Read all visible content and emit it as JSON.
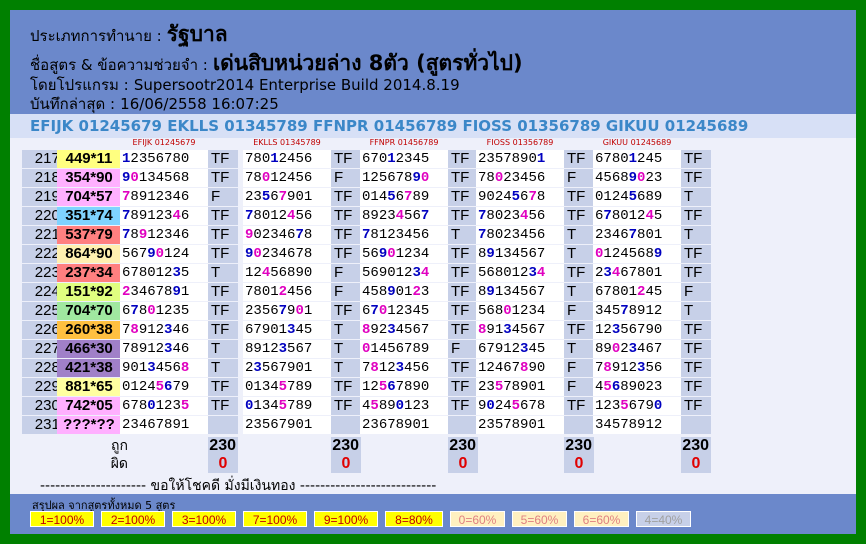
{
  "header": {
    "type_label": "ประเภทการทำนาย :",
    "type_value": "รัฐบาล",
    "formula_label": "ชื่อสูตร & ข้อความช่วยจำ :",
    "formula_value": "เด่นสิบหน่วยล่าง 8ตัว (สูตรทั่วไป)",
    "program_label": "โดยโปรแกรม :",
    "program_value": "Supersootr2014 Enterprise Build 2014.8.19",
    "saved_label": "บันทึกล่าสุด :",
    "saved_value": "16/06/2558 16:07:25"
  },
  "codes_line": "EFIJK 01245679 EKLLS 01345789 FFNPR 01456789 FIOSS 01356789 GIKUU 01245689",
  "columns": [
    "EFIJK 01245679",
    "EKLLS 01345789",
    "FFNPR 01456789",
    "FIOSS 01356789",
    "GIKUU 01245689"
  ],
  "rows": [
    {
      "num": "217.",
      "res": "449*11",
      "color": "#ffff80",
      "cells": [
        [
          "12356780",
          "TF"
        ],
        [
          "78012456",
          "TF"
        ],
        [
          "67012345",
          "TF"
        ],
        [
          "23578901",
          "TF"
        ],
        [
          "67801245",
          "TF"
        ]
      ]
    },
    {
      "num": "218.",
      "res": "354*90",
      "color": "#ffb0ff",
      "cells": [
        [
          "90134568",
          "TF"
        ],
        [
          "78012456",
          "F"
        ],
        [
          "12567890",
          "TF"
        ],
        [
          "78023456",
          "F"
        ],
        [
          "45689023",
          "TF"
        ]
      ]
    },
    {
      "num": "219.",
      "res": "704*57",
      "color": "#ffb0ff",
      "cells": [
        [
          "78912346",
          "F"
        ],
        [
          "23567901",
          "TF"
        ],
        [
          "01456789",
          "TF"
        ],
        [
          "90245678",
          "TF"
        ],
        [
          "01245689",
          "T"
        ]
      ]
    },
    {
      "num": "220.",
      "res": "351*74",
      "color": "#7fd3ff",
      "cells": [
        [
          "78912346",
          "TF"
        ],
        [
          "78012456",
          "TF"
        ],
        [
          "89234567",
          "TF"
        ],
        [
          "78023456",
          "TF"
        ],
        [
          "67801245",
          "TF"
        ]
      ]
    },
    {
      "num": "221.",
      "res": "537*79",
      "color": "#ff8080",
      "cells": [
        [
          "78912346",
          "TF"
        ],
        [
          "90234678",
          "TF"
        ],
        [
          "78123456",
          "T"
        ],
        [
          "78023456",
          "T"
        ],
        [
          "23467801",
          "T"
        ]
      ]
    },
    {
      "num": "222.",
      "res": "864*90",
      "color": "#fff0b0",
      "cells": [
        [
          "56790124",
          "TF"
        ],
        [
          "90234678",
          "TF"
        ],
        [
          "56901234",
          "TF"
        ],
        [
          "89134567",
          "T"
        ],
        [
          "01245689",
          "TF"
        ]
      ]
    },
    {
      "num": "223.",
      "res": "237*34",
      "color": "#ff8080",
      "cells": [
        [
          "67801235",
          "T"
        ],
        [
          "12456890",
          "F"
        ],
        [
          "56901234",
          "TF"
        ],
        [
          "56801234",
          "TF"
        ],
        [
          "23467801",
          "TF"
        ]
      ]
    },
    {
      "num": "224.",
      "res": "151*92",
      "color": "#e0ff80",
      "cells": [
        [
          "23467891",
          "TF"
        ],
        [
          "78012456",
          "F"
        ],
        [
          "45890123",
          "TF"
        ],
        [
          "89134567",
          "T"
        ],
        [
          "67801245",
          "F"
        ]
      ]
    },
    {
      "num": "225.",
      "res": "704*70",
      "color": "#a0e8a0",
      "cells": [
        [
          "67801235",
          "TF"
        ],
        [
          "23567901",
          "TF"
        ],
        [
          "67012345",
          "TF"
        ],
        [
          "56801234",
          "F"
        ],
        [
          "34578912",
          "T"
        ]
      ]
    },
    {
      "num": "226.",
      "res": "260*38",
      "color": "#ffc040",
      "cells": [
        [
          "78912346",
          "TF"
        ],
        [
          "67901345",
          "T"
        ],
        [
          "89234567",
          "TF"
        ],
        [
          "89134567",
          "TF"
        ],
        [
          "12356790",
          "TF"
        ]
      ]
    },
    {
      "num": "227.",
      "res": "466*30",
      "color": "#a080c8",
      "cells": [
        [
          "78912346",
          "T"
        ],
        [
          "89123567",
          "T"
        ],
        [
          "01456789",
          "F"
        ],
        [
          "67912345",
          "T"
        ],
        [
          "89023467",
          "TF"
        ]
      ]
    },
    {
      "num": "228.",
      "res": "421*38",
      "color": "#a080c8",
      "cells": [
        [
          "90134568",
          "T"
        ],
        [
          "23567901",
          "T"
        ],
        [
          "78123456",
          "TF"
        ],
        [
          "12467890",
          "F"
        ],
        [
          "78912356",
          "TF"
        ]
      ]
    },
    {
      "num": "229.",
      "res": "881*65",
      "color": "#ffffa0",
      "cells": [
        [
          "01245679",
          "TF"
        ],
        [
          "01345789",
          "TF"
        ],
        [
          "12567890",
          "TF"
        ],
        [
          "23578901",
          "F"
        ],
        [
          "45689023",
          "TF"
        ]
      ]
    },
    {
      "num": "230.",
      "res": "742*05",
      "color": "#ffb0ff",
      "cells": [
        [
          "67801235",
          "TF"
        ],
        [
          "01345789",
          "TF"
        ],
        [
          "45890123",
          "TF"
        ],
        [
          "90245678",
          "TF"
        ],
        [
          "12356790",
          "TF"
        ]
      ]
    },
    {
      "num": "231.",
      "res": "???*??",
      "color": "#ffb0ff",
      "cells": [
        [
          "23467891",
          ""
        ],
        [
          "23567901",
          ""
        ],
        [
          "23678901",
          ""
        ],
        [
          "23578901",
          ""
        ],
        [
          "34578912",
          ""
        ]
      ]
    }
  ],
  "stats": {
    "correct_label": "ถูก",
    "wrong_label": "ผิด",
    "correct": [
      "230",
      "230",
      "230",
      "230",
      "230"
    ],
    "wrong": [
      "0",
      "0",
      "0",
      "0",
      "0"
    ]
  },
  "footer_line": "--------------------- ขอให้โชคดี มั่งมีเงินทอง ---------------------------",
  "summary": {
    "title": "สรุปผล จากสูตรทั้งหมด 5 สูตร",
    "badges": [
      {
        "text": "1=100%",
        "bg": "#ffff00",
        "fg": "#c00000"
      },
      {
        "text": "2=100%",
        "bg": "#ffff00",
        "fg": "#c00000"
      },
      {
        "text": "3=100%",
        "bg": "#ffff00",
        "fg": "#c00000"
      },
      {
        "text": "7=100%",
        "bg": "#ffff00",
        "fg": "#c00000"
      },
      {
        "text": "9=100%",
        "bg": "#ffff00",
        "fg": "#c00000"
      },
      {
        "text": "8=80%",
        "bg": "#ffff00",
        "fg": "#c00000"
      },
      {
        "text": "0=60%",
        "bg": "#fff0c0",
        "fg": "#e08080"
      },
      {
        "text": "5=60%",
        "bg": "#fff0c0",
        "fg": "#e08080"
      },
      {
        "text": "6=60%",
        "bg": "#fff0c0",
        "fg": "#e08080"
      },
      {
        "text": "4=40%",
        "bg": "#c7d0e8",
        "fg": "#a0a0a0"
      }
    ]
  }
}
